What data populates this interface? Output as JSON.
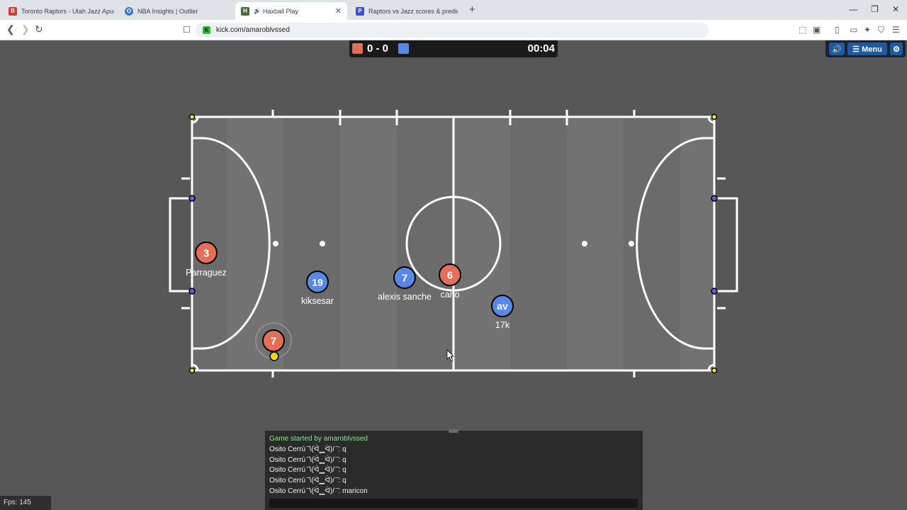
{
  "browser": {
    "tabs": [
      {
        "title": "Toronto Raptors - Utah Jazz Apuestas",
        "favicon_color": "#d23b2f",
        "favicon_glyph": "B"
      },
      {
        "title": "NBA Insights | Outlier",
        "favicon_color": "#3a78c8",
        "favicon_glyph": "O"
      },
      {
        "title": "Haxball Play",
        "favicon_color": "#4a6b3a",
        "favicon_glyph": "H",
        "audio": "🔊"
      },
      {
        "title": "Raptors vs Jazz scores & predictions",
        "favicon_color": "#3b4fd1",
        "favicon_glyph": "P"
      }
    ],
    "new_tab": "+",
    "window_controls": {
      "minimize": "—",
      "restore": "❐",
      "close": "✕"
    },
    "url": "kick.com/amaroblvssed",
    "site_icon_glyph": "K"
  },
  "hud": {
    "score": "0 - 0",
    "timer": "00:04",
    "red_color": "#e56e56",
    "blue_color": "#5689e5",
    "menu_label": "☰ Menu",
    "sound_icon": "🔊",
    "settings_icon": "⚙"
  },
  "players": [
    {
      "label": "3",
      "name": "Parraguez",
      "team": "red"
    },
    {
      "label": "19",
      "name": "kiksesar",
      "team": "blue"
    },
    {
      "label": "7",
      "name": "alexis sanche",
      "team": "blue"
    },
    {
      "label": "6",
      "name": "carlo",
      "team": "red"
    },
    {
      "label": "av",
      "name": "17k",
      "team": "blue"
    },
    {
      "label": "7",
      "name": "",
      "team": "red"
    }
  ],
  "chat": {
    "lines": [
      {
        "text": "Game started by amaroblvssed",
        "system": true
      },
      {
        "text": "Osito Cerrú ̄ ̄\\(ᐛ▁ᐛ)/ ̄ ̄: q"
      },
      {
        "text": "Osito Cerrú ̄ ̄\\(ᐛ▁ᐛ)/ ̄ ̄: q"
      },
      {
        "text": "Osito Cerrú ̄ ̄\\(ᐛ▁ᐛ)/ ̄ ̄: q"
      },
      {
        "text": "Osito Cerrú ̄ ̄\\(ᐛ▁ᐛ)/ ̄ ̄: q"
      },
      {
        "text": "Osito Cerrú ̄ ̄\\(ᐛ▁ᐛ)/ ̄ ̄: maricon"
      }
    ]
  },
  "fps": "Fps: 145"
}
